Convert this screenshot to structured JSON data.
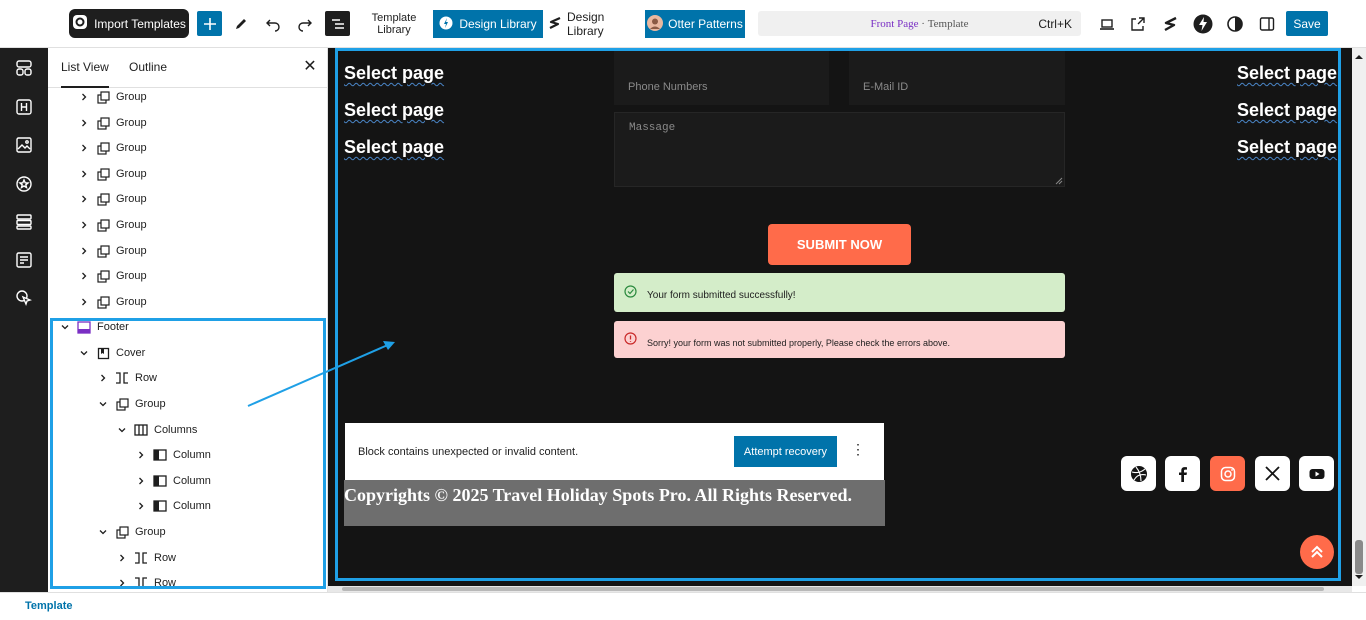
{
  "toolbar": {
    "import_templates_label": "Import Templates",
    "template_library_line1": "Template",
    "template_library_line2": "Library",
    "design_library_label": "Design Library",
    "design_library_label_2": "Design Library",
    "otter_patterns_label": "Otter Patterns",
    "command_bar_page": "Front Page",
    "command_bar_separator": " · ",
    "command_bar_type": "Template",
    "command_bar_shortcut": "Ctrl+K",
    "save_label": "Save"
  },
  "panel": {
    "tab_list_view": "List View",
    "tab_outline": "Outline",
    "close_glyph": "✕",
    "items": [
      {
        "label": "Group"
      },
      {
        "label": "Group"
      },
      {
        "label": "Group"
      },
      {
        "label": "Group"
      },
      {
        "label": "Group"
      },
      {
        "label": "Group"
      },
      {
        "label": "Group"
      },
      {
        "label": "Group"
      },
      {
        "label": "Group"
      },
      {
        "label": "Footer"
      },
      {
        "label": "Cover"
      },
      {
        "label": "Row"
      },
      {
        "label": "Group"
      },
      {
        "label": "Columns"
      },
      {
        "label": "Column"
      },
      {
        "label": "Column"
      },
      {
        "label": "Column"
      },
      {
        "label": "Group"
      },
      {
        "label": "Row"
      },
      {
        "label": "Row"
      }
    ]
  },
  "canvas": {
    "select_page": "Select page",
    "form": {
      "phone_placeholder": "Phone Numbers",
      "email_placeholder": "E-Mail ID",
      "message_placeholder": "Massage"
    },
    "submit_label": "SUBMIT NOW",
    "success_message": "Your form submitted successfully!",
    "error_message": "Sorry! your form was not submitted properly, Please check the errors above.",
    "invalid_block_message": "Block contains unexpected or invalid content.",
    "attempt_recovery_label": "Attempt recovery",
    "more_glyph": "⋮",
    "copyright": "Copyrights © 2025 Travel Holiday Spots Pro. All Rights Reserved.",
    "social_icons": [
      "dribbble-icon",
      "facebook-icon",
      "instagram-icon",
      "x-icon",
      "youtube-icon"
    ]
  },
  "status": {
    "breadcrumb": "Template"
  },
  "colors": {
    "accent": "#0073aa",
    "highlight": "#1fa0e6",
    "orange": "#ff6b4a",
    "success_bg": "#d4edc9",
    "error_bg": "#fcd1d1"
  }
}
